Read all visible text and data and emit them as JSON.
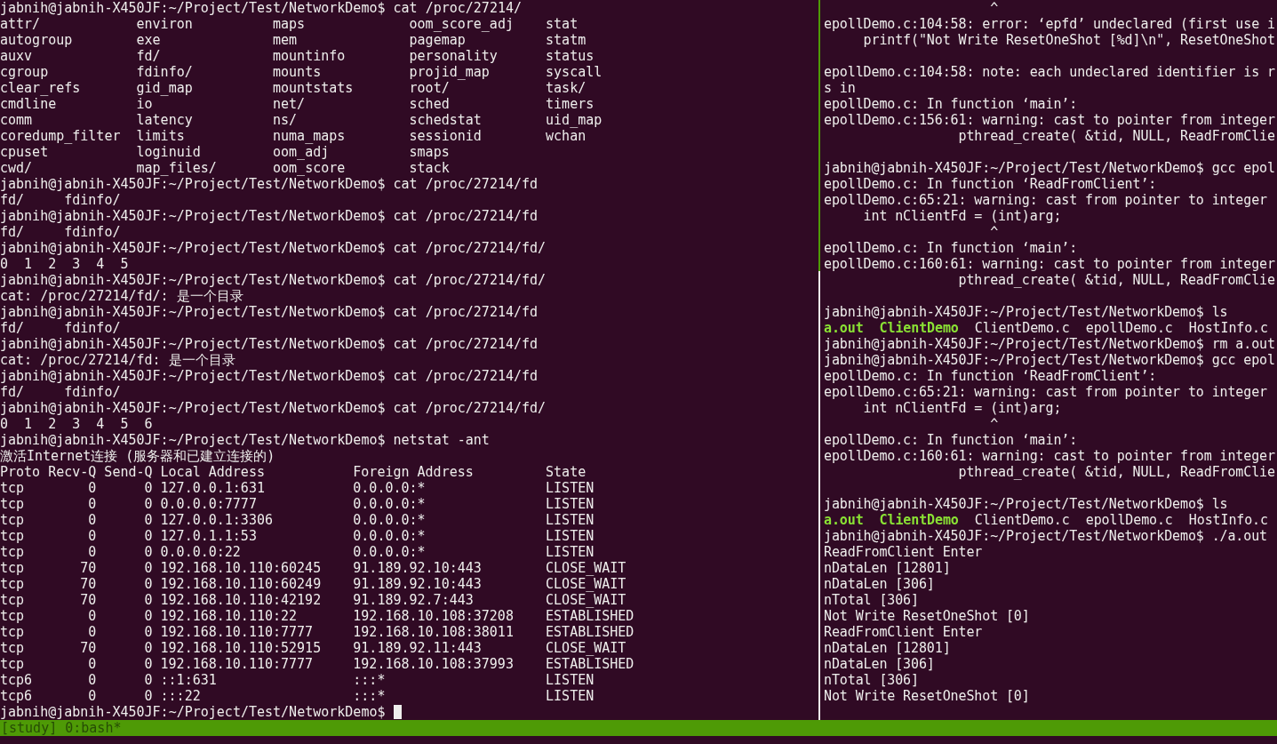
{
  "left_pane": {
    "active": true,
    "lines": [
      {
        "kind": "prompt",
        "text": "jabnih@jabnih-X450JF:~/Project/Test/NetworkDemo$ cat /proc/27214/"
      },
      {
        "kind": "listing",
        "cells": [
          "attr/",
          "environ",
          "maps",
          "oom_score_adj",
          "stat"
        ]
      },
      {
        "kind": "listing",
        "cells": [
          "autogroup",
          "exe",
          "mem",
          "pagemap",
          "statm"
        ]
      },
      {
        "kind": "listing",
        "cells": [
          "auxv",
          "fd/",
          "mountinfo",
          "personality",
          "status"
        ]
      },
      {
        "kind": "listing",
        "cells": [
          "cgroup",
          "fdinfo/",
          "mounts",
          "projid_map",
          "syscall"
        ]
      },
      {
        "kind": "listing",
        "cells": [
          "clear_refs",
          "gid_map",
          "mountstats",
          "root/",
          "task/"
        ]
      },
      {
        "kind": "listing",
        "cells": [
          "cmdline",
          "io",
          "net/",
          "sched",
          "timers"
        ]
      },
      {
        "kind": "listing",
        "cells": [
          "comm",
          "latency",
          "ns/",
          "schedstat",
          "uid_map"
        ]
      },
      {
        "kind": "listing",
        "cells": [
          "coredump_filter",
          "limits",
          "numa_maps",
          "sessionid",
          "wchan"
        ]
      },
      {
        "kind": "listing",
        "cells": [
          "cpuset",
          "loginuid",
          "oom_adj",
          "smaps"
        ]
      },
      {
        "kind": "listing",
        "cells": [
          "cwd/",
          "map_files/",
          "oom_score",
          "stack"
        ]
      },
      {
        "kind": "prompt",
        "text": "jabnih@jabnih-X450JF:~/Project/Test/NetworkDemo$ cat /proc/27214/fd"
      },
      {
        "kind": "output",
        "text": "fd/     fdinfo/"
      },
      {
        "kind": "prompt",
        "text": "jabnih@jabnih-X450JF:~/Project/Test/NetworkDemo$ cat /proc/27214/fd"
      },
      {
        "kind": "output",
        "text": "fd/     fdinfo/"
      },
      {
        "kind": "prompt",
        "text": "jabnih@jabnih-X450JF:~/Project/Test/NetworkDemo$ cat /proc/27214/fd/"
      },
      {
        "kind": "output",
        "text": "0  1  2  3  4  5"
      },
      {
        "kind": "prompt",
        "text": "jabnih@jabnih-X450JF:~/Project/Test/NetworkDemo$ cat /proc/27214/fd/"
      },
      {
        "kind": "output",
        "text": "cat: /proc/27214/fd/: 是一个目录"
      },
      {
        "kind": "prompt",
        "text": "jabnih@jabnih-X450JF:~/Project/Test/NetworkDemo$ cat /proc/27214/fd"
      },
      {
        "kind": "output",
        "text": "fd/     fdinfo/"
      },
      {
        "kind": "prompt",
        "text": "jabnih@jabnih-X450JF:~/Project/Test/NetworkDemo$ cat /proc/27214/fd"
      },
      {
        "kind": "output",
        "text": "cat: /proc/27214/fd: 是一个目录"
      },
      {
        "kind": "prompt",
        "text": "jabnih@jabnih-X450JF:~/Project/Test/NetworkDemo$ cat /proc/27214/fd"
      },
      {
        "kind": "output",
        "text": "fd/     fdinfo/"
      },
      {
        "kind": "prompt",
        "text": "jabnih@jabnih-X450JF:~/Project/Test/NetworkDemo$ cat /proc/27214/fd/"
      },
      {
        "kind": "output",
        "text": "0  1  2  3  4  5  6"
      },
      {
        "kind": "prompt",
        "text": "jabnih@jabnih-X450JF:~/Project/Test/NetworkDemo$ netstat -ant"
      },
      {
        "kind": "output",
        "text": "激活Internet连接 (服务器和已建立连接的)"
      },
      {
        "kind": "header",
        "cells": [
          "Proto",
          "Recv-Q",
          "Send-Q",
          "Local Address",
          "Foreign Address",
          "State"
        ]
      },
      {
        "kind": "table",
        "cells": [
          "tcp",
          "0",
          "0",
          "127.0.0.1:631",
          "0.0.0.0:*",
          "LISTEN"
        ]
      },
      {
        "kind": "table",
        "cells": [
          "tcp",
          "0",
          "0",
          "0.0.0.0:7777",
          "0.0.0.0:*",
          "LISTEN"
        ]
      },
      {
        "kind": "table",
        "cells": [
          "tcp",
          "0",
          "0",
          "127.0.0.1:3306",
          "0.0.0.0:*",
          "LISTEN"
        ]
      },
      {
        "kind": "table",
        "cells": [
          "tcp",
          "0",
          "0",
          "127.0.1.1:53",
          "0.0.0.0:*",
          "LISTEN"
        ]
      },
      {
        "kind": "table",
        "cells": [
          "tcp",
          "0",
          "0",
          "0.0.0.0:22",
          "0.0.0.0:*",
          "LISTEN"
        ]
      },
      {
        "kind": "table",
        "cells": [
          "tcp",
          "70",
          "0",
          "192.168.10.110:60245",
          "91.189.92.10:443",
          "CLOSE_WAIT"
        ]
      },
      {
        "kind": "table",
        "cells": [
          "tcp",
          "70",
          "0",
          "192.168.10.110:60249",
          "91.189.92.10:443",
          "CLOSE_WAIT"
        ]
      },
      {
        "kind": "table",
        "cells": [
          "tcp",
          "70",
          "0",
          "192.168.10.110:42192",
          "91.189.92.7:443",
          "CLOSE_WAIT"
        ]
      },
      {
        "kind": "table",
        "cells": [
          "tcp",
          "0",
          "0",
          "192.168.10.110:22",
          "192.168.10.108:37208",
          "ESTABLISHED"
        ]
      },
      {
        "kind": "table",
        "cells": [
          "tcp",
          "0",
          "0",
          "192.168.10.110:7777",
          "192.168.10.108:38011",
          "ESTABLISHED"
        ]
      },
      {
        "kind": "table",
        "cells": [
          "tcp",
          "70",
          "0",
          "192.168.10.110:52915",
          "91.189.92.11:443",
          "CLOSE_WAIT"
        ]
      },
      {
        "kind": "table",
        "cells": [
          "tcp",
          "0",
          "0",
          "192.168.10.110:7777",
          "192.168.10.108:37993",
          "ESTABLISHED"
        ]
      },
      {
        "kind": "table",
        "cells": [
          "tcp6",
          "0",
          "0",
          "::1:631",
          ":::*",
          "LISTEN"
        ]
      },
      {
        "kind": "table",
        "cells": [
          "tcp6",
          "0",
          "0",
          ":::22",
          ":::*",
          "LISTEN"
        ]
      },
      {
        "kind": "input",
        "text": "jabnih@jabnih-X450JF:~/Project/Test/NetworkDemo$"
      }
    ]
  },
  "right_pane": {
    "lines": [
      {
        "kind": "output",
        "text": "                     ^"
      },
      {
        "kind": "output",
        "text": "epollDemo.c:104:58: error: ‘epfd’ undeclared (first use i"
      },
      {
        "kind": "output",
        "text": "     printf(\"Not Write ResetOneShot [%d]\\n\", ResetOneShot"
      },
      {
        "kind": "blank"
      },
      {
        "kind": "output",
        "text": "epollDemo.c:104:58: note: each undeclared identifier is r"
      },
      {
        "kind": "output",
        "text": "s in"
      },
      {
        "kind": "output",
        "text": "epollDemo.c: In function ‘main’:"
      },
      {
        "kind": "output",
        "text": "epollDemo.c:156:61: warning: cast to pointer from integer"
      },
      {
        "kind": "output",
        "text": "                 pthread_create( &tid, NULL, ReadFromClie"
      },
      {
        "kind": "blank"
      },
      {
        "kind": "prompt",
        "text": "jabnih@jabnih-X450JF:~/Project/Test/NetworkDemo$ gcc epol"
      },
      {
        "kind": "output",
        "text": "epollDemo.c: In function ‘ReadFromClient’:"
      },
      {
        "kind": "output",
        "text": "epollDemo.c:65:21: warning: cast from pointer to integer"
      },
      {
        "kind": "output",
        "text": "     int nClientFd = (int)arg;"
      },
      {
        "kind": "output",
        "text": "                     ^"
      },
      {
        "kind": "output",
        "text": "epollDemo.c: In function ‘main’:"
      },
      {
        "kind": "output",
        "text": "epollDemo.c:160:61: warning: cast to pointer from integer"
      },
      {
        "kind": "output",
        "text": "                 pthread_create( &tid, NULL, ReadFromClie"
      },
      {
        "kind": "blank"
      },
      {
        "kind": "prompt",
        "text": "jabnih@jabnih-X450JF:~/Project/Test/NetworkDemo$ ls"
      },
      {
        "kind": "files",
        "parts": [
          {
            "text": "a.out",
            "executable": true
          },
          {
            "text": "ClientDemo",
            "executable": true
          },
          {
            "text": "ClientDemo.c",
            "executable": false
          },
          {
            "text": "epollDemo.c",
            "executable": false
          },
          {
            "text": "HostInfo.c",
            "executable": false
          }
        ]
      },
      {
        "kind": "prompt",
        "text": "jabnih@jabnih-X450JF:~/Project/Test/NetworkDemo$ rm a.out"
      },
      {
        "kind": "prompt",
        "text": "jabnih@jabnih-X450JF:~/Project/Test/NetworkDemo$ gcc epol"
      },
      {
        "kind": "output",
        "text": "epollDemo.c: In function ‘ReadFromClient’:"
      },
      {
        "kind": "output",
        "text": "epollDemo.c:65:21: warning: cast from pointer to integer"
      },
      {
        "kind": "output",
        "text": "     int nClientFd = (int)arg;"
      },
      {
        "kind": "output",
        "text": "                     ^"
      },
      {
        "kind": "output",
        "text": "epollDemo.c: In function ‘main’:"
      },
      {
        "kind": "output",
        "text": "epollDemo.c:160:61: warning: cast to pointer from integer"
      },
      {
        "kind": "output",
        "text": "                 pthread_create( &tid, NULL, ReadFromClie"
      },
      {
        "kind": "blank"
      },
      {
        "kind": "prompt",
        "text": "jabnih@jabnih-X450JF:~/Project/Test/NetworkDemo$ ls"
      },
      {
        "kind": "files",
        "parts": [
          {
            "text": "a.out",
            "executable": true
          },
          {
            "text": "ClientDemo",
            "executable": true
          },
          {
            "text": "ClientDemo.c",
            "executable": false
          },
          {
            "text": "epollDemo.c",
            "executable": false
          },
          {
            "text": "HostInfo.c",
            "executable": false
          }
        ]
      },
      {
        "kind": "prompt",
        "text": "jabnih@jabnih-X450JF:~/Project/Test/NetworkDemo$ ./a.out"
      },
      {
        "kind": "output",
        "text": "ReadFromClient Enter"
      },
      {
        "kind": "output",
        "text": "nDataLen [12801]"
      },
      {
        "kind": "output",
        "text": "nDataLen [306]"
      },
      {
        "kind": "output",
        "text": "nTotal [306]"
      },
      {
        "kind": "output",
        "text": "Not Write ResetOneShot [0]"
      },
      {
        "kind": "output",
        "text": "ReadFromClient Enter"
      },
      {
        "kind": "output",
        "text": "nDataLen [12801]"
      },
      {
        "kind": "output",
        "text": "nDataLen [306]"
      },
      {
        "kind": "output",
        "text": "nTotal [306]"
      },
      {
        "kind": "output",
        "text": "Not Write ResetOneShot [0]"
      }
    ]
  },
  "status_bar": {
    "text": "[study] 0:bash*"
  }
}
